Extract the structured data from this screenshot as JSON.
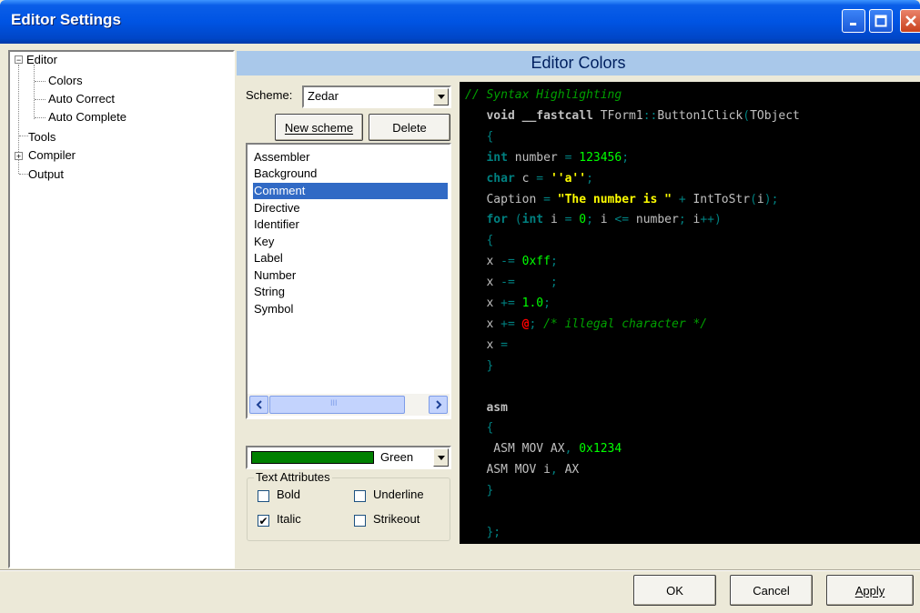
{
  "window": {
    "title": "Editor Settings",
    "buttons": {
      "minimize": "minimize",
      "maximize": "maximize",
      "close": "close"
    }
  },
  "tree": {
    "items": [
      {
        "label": "Editor",
        "expander": "−"
      },
      {
        "label": "Colors"
      },
      {
        "label": "Auto Correct"
      },
      {
        "label": "Auto Complete"
      },
      {
        "label": "Tools"
      },
      {
        "label": "Compiler",
        "expander": "+"
      },
      {
        "label": "Output"
      }
    ]
  },
  "panel": {
    "heading": "Editor Colors",
    "scheme_label": "Scheme:",
    "scheme_value": "Zedar",
    "new_scheme_label": "New scheme",
    "delete_label": "Delete",
    "elements": [
      "Assembler",
      "Background",
      "Comment",
      "Directive",
      "Identifier",
      "Key",
      "Label",
      "Number",
      "String",
      "Symbol"
    ],
    "selected_element": "Comment",
    "scroll_grip": "III",
    "color_name": "Green",
    "color_hex": "#008000",
    "attributes_label": "Text Attributes",
    "bold_label": "Bold",
    "underline_label": "Underline",
    "italic_label": "Italic",
    "strikeout_label": "Strikeout",
    "italic_checked": "✔"
  },
  "code_preview": {
    "lines": [
      [
        [
          "comment",
          "// Syntax Highlighting"
        ]
      ],
      [
        [
          "kw",
          "   void "
        ],
        [
          "kw",
          "__fastcall "
        ],
        [
          "ident",
          "TForm1"
        ],
        [
          "sym",
          "::"
        ],
        [
          "ident",
          "Button1Click"
        ],
        [
          "sym",
          "("
        ],
        [
          "ident",
          "TObject"
        ]
      ],
      [
        [
          "sym",
          "   {"
        ]
      ],
      [
        [
          "key",
          "   int "
        ],
        [
          "ident",
          "number "
        ],
        [
          "sym",
          "= "
        ],
        [
          "num",
          "123456"
        ],
        [
          "sym",
          ";"
        ]
      ],
      [
        [
          "key",
          "   char "
        ],
        [
          "ident",
          "c "
        ],
        [
          "sym",
          "= "
        ],
        [
          "str",
          "''a''"
        ],
        [
          "sym",
          ";"
        ]
      ],
      [
        [
          "ident",
          "   Caption "
        ],
        [
          "sym",
          "= "
        ],
        [
          "str",
          "\"The number is \" "
        ],
        [
          "sym",
          "+ "
        ],
        [
          "ident",
          "IntToStr"
        ],
        [
          "sym",
          "("
        ],
        [
          "ident",
          "i"
        ],
        [
          "sym",
          ");"
        ]
      ],
      [
        [
          "key",
          "   for "
        ],
        [
          "sym",
          "("
        ],
        [
          "key",
          "int "
        ],
        [
          "ident",
          "i "
        ],
        [
          "sym",
          "= "
        ],
        [
          "num",
          "0"
        ],
        [
          "sym",
          "; "
        ],
        [
          "ident",
          "i "
        ],
        [
          "sym",
          "<= "
        ],
        [
          "ident",
          "number"
        ],
        [
          "sym",
          "; "
        ],
        [
          "ident",
          "i"
        ],
        [
          "sym",
          "++)"
        ]
      ],
      [
        [
          "sym",
          "   {"
        ]
      ],
      [
        [
          "ident",
          "   x "
        ],
        [
          "sym",
          "-= "
        ],
        [
          "num",
          "0xff"
        ],
        [
          "sym",
          ";"
        ]
      ],
      [
        [
          "ident",
          "   x "
        ],
        [
          "sym",
          "-=     ;"
        ]
      ],
      [
        [
          "ident",
          "   x "
        ],
        [
          "sym",
          "+= "
        ],
        [
          "num",
          "1.0"
        ],
        [
          "sym",
          ";"
        ]
      ],
      [
        [
          "ident",
          "   x "
        ],
        [
          "sym",
          "+= "
        ],
        [
          "ill",
          "@"
        ],
        [
          "sym",
          "; "
        ],
        [
          "comment",
          "/* illegal character */"
        ]
      ],
      [
        [
          "ident",
          "   x "
        ],
        [
          "sym",
          "="
        ]
      ],
      [
        [
          "sym",
          "   }"
        ]
      ],
      [
        [
          "ident",
          ""
        ]
      ],
      [
        [
          "kw",
          "   asm"
        ]
      ],
      [
        [
          "sym",
          "   {"
        ]
      ],
      [
        [
          "ident",
          "    ASM MOV AX"
        ],
        [
          "sym",
          ", "
        ],
        [
          "num",
          "0x1234"
        ]
      ],
      [
        [
          "ident",
          "   ASM MOV i"
        ],
        [
          "sym",
          ", "
        ],
        [
          "ident",
          "AX"
        ]
      ],
      [
        [
          "sym",
          "   }"
        ]
      ],
      [
        [
          "ident",
          ""
        ]
      ],
      [
        [
          "sym",
          "   };"
        ]
      ]
    ]
  },
  "footer": {
    "ok_label": "OK",
    "cancel_label": "Cancel",
    "apply_label": "Apply"
  }
}
